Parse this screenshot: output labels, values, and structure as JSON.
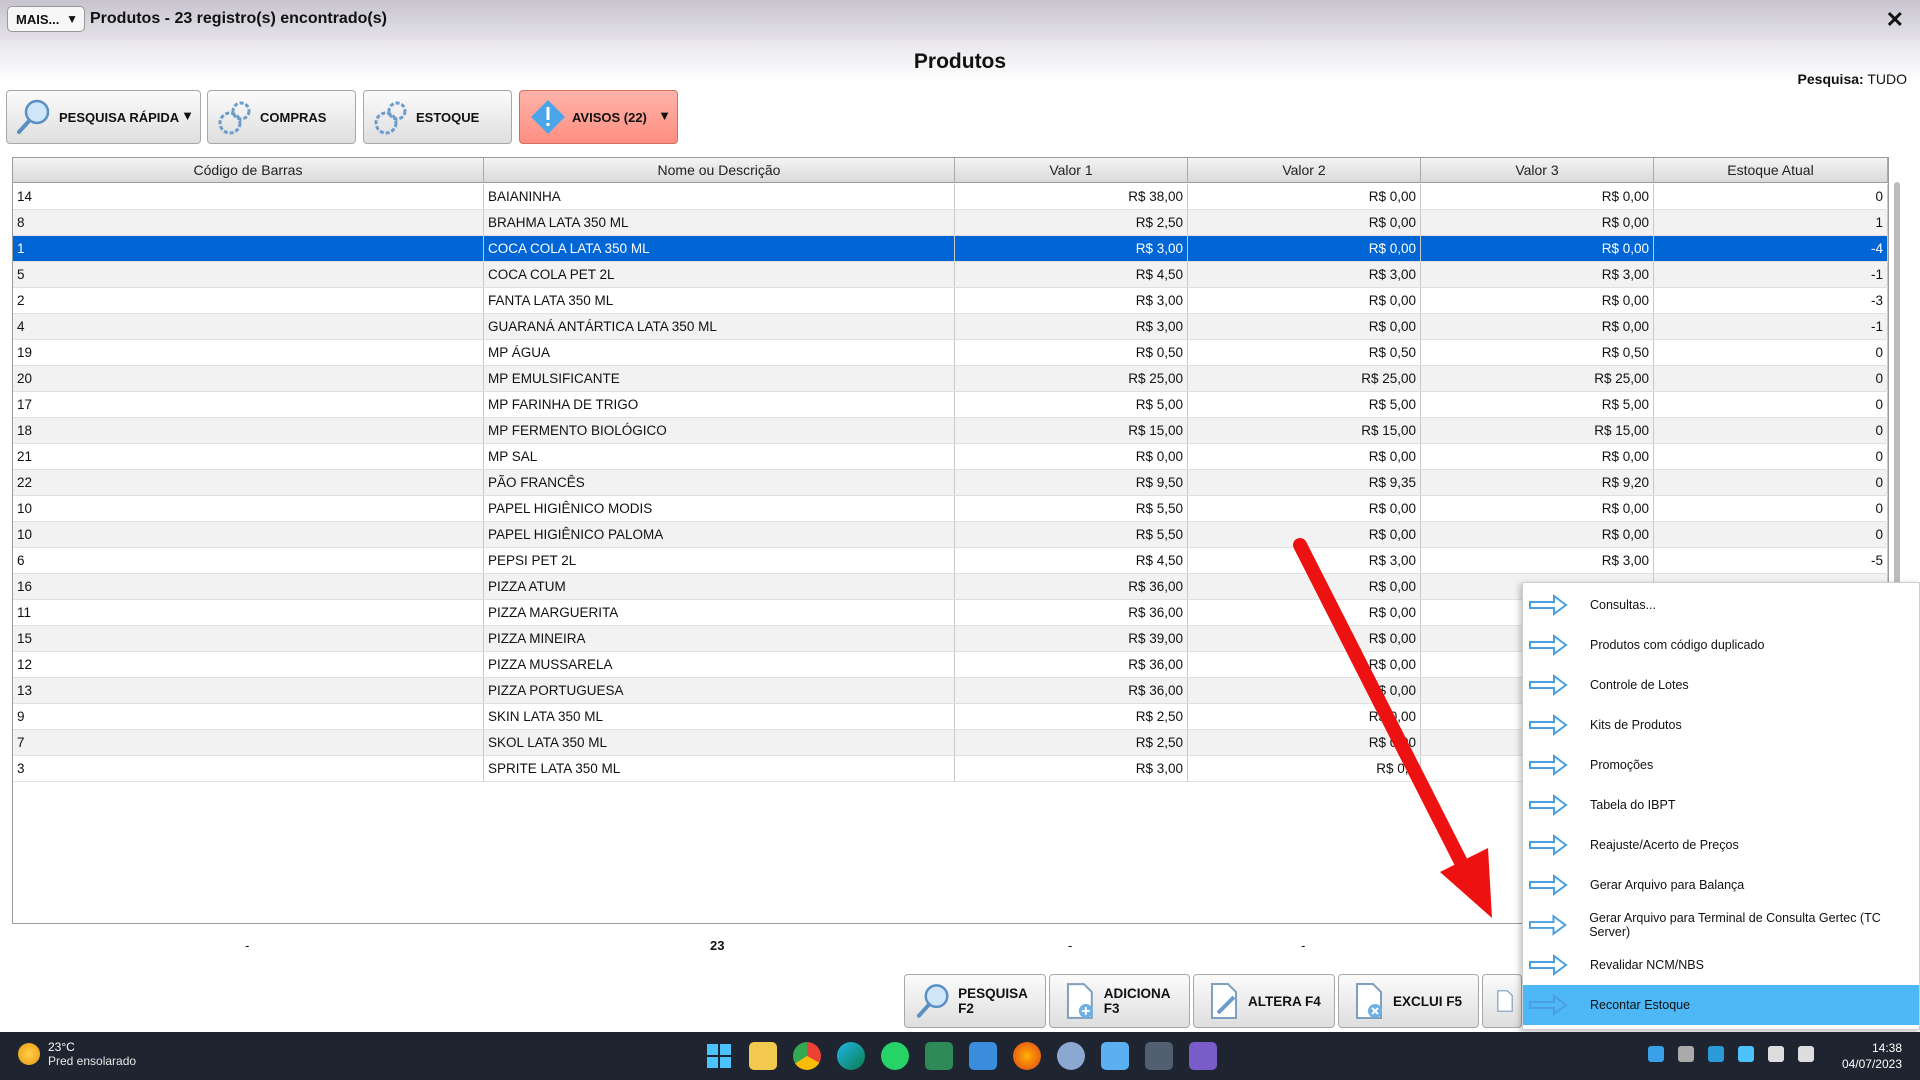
{
  "window": {
    "mais_label": "MAIS...",
    "title": "Produtos - 23 registro(s) encontrado(s)",
    "page_heading": "Produtos",
    "search_prefix": "Pesquisa:",
    "search_value": "TUDO"
  },
  "toolbar": {
    "quick_search": "PESQUISA RÁPIDA",
    "purchases": "COMPRAS",
    "stock": "ESTOQUE",
    "alerts": "AVISOS (22)"
  },
  "table": {
    "columns": [
      "Código de Barras",
      "Nome ou Descrição",
      "Valor 1",
      "Valor 2",
      "Valor 3",
      "Estoque Atual"
    ],
    "rows": [
      [
        "14",
        "BAIANINHA",
        "R$ 38,00",
        "R$ 0,00",
        "R$ 0,00",
        "0"
      ],
      [
        "8",
        "BRAHMA LATA 350 ML",
        "R$ 2,50",
        "R$ 0,00",
        "R$ 0,00",
        "1"
      ],
      [
        "1",
        "COCA COLA LATA 350 ML",
        "R$ 3,00",
        "R$ 0,00",
        "R$ 0,00",
        "-4"
      ],
      [
        "5",
        "COCA COLA PET 2L",
        "R$ 4,50",
        "R$ 3,00",
        "R$ 3,00",
        "-1"
      ],
      [
        "2",
        "FANTA LATA 350 ML",
        "R$ 3,00",
        "R$ 0,00",
        "R$ 0,00",
        "-3"
      ],
      [
        "4",
        "GUARANÁ ANTÁRTICA LATA 350 ML",
        "R$ 3,00",
        "R$ 0,00",
        "R$ 0,00",
        "-1"
      ],
      [
        "19",
        "MP ÁGUA",
        "R$ 0,50",
        "R$ 0,50",
        "R$ 0,50",
        "0"
      ],
      [
        "20",
        "MP EMULSIFICANTE",
        "R$ 25,00",
        "R$ 25,00",
        "R$ 25,00",
        "0"
      ],
      [
        "17",
        "MP FARINHA DE TRIGO",
        "R$ 5,00",
        "R$ 5,00",
        "R$ 5,00",
        "0"
      ],
      [
        "18",
        "MP FERMENTO BIOLÓGICO",
        "R$ 15,00",
        "R$ 15,00",
        "R$ 15,00",
        "0"
      ],
      [
        "21",
        "MP SAL",
        "R$ 0,00",
        "R$ 0,00",
        "R$ 0,00",
        "0"
      ],
      [
        "22",
        "PÃO FRANCÊS",
        "R$ 9,50",
        "R$ 9,35",
        "R$ 9,20",
        "0"
      ],
      [
        "10",
        "PAPEL HIGIÊNICO MODIS",
        "R$ 5,50",
        "R$ 0,00",
        "R$ 0,00",
        "0"
      ],
      [
        "10",
        "PAPEL HIGIÊNICO PALOMA",
        "R$ 5,50",
        "R$ 0,00",
        "R$ 0,00",
        "0"
      ],
      [
        "6",
        "PEPSI PET 2L",
        "R$ 4,50",
        "R$ 3,00",
        "R$ 3,00",
        "-5"
      ],
      [
        "16",
        "PIZZA ATUM",
        "R$ 36,00",
        "R$ 0,00",
        "",
        ""
      ],
      [
        "11",
        "PIZZA MARGUERITA",
        "R$ 36,00",
        "R$ 0,00",
        "",
        ""
      ],
      [
        "15",
        "PIZZA MINEIRA",
        "R$ 39,00",
        "R$ 0,00",
        "",
        ""
      ],
      [
        "12",
        "PIZZA MUSSARELA",
        "R$ 36,00",
        "R$ 0,00",
        "",
        ""
      ],
      [
        "13",
        "PIZZA PORTUGUESA",
        "R$ 36,00",
        "R$ 0,00",
        "",
        ""
      ],
      [
        "9",
        "SKIN LATA 350 ML",
        "R$ 2,50",
        "R$ 0,00",
        "",
        ""
      ],
      [
        "7",
        "SKOL LATA 350 ML",
        "R$ 2,50",
        "R$ 0,00",
        "",
        ""
      ],
      [
        "3",
        "SPRITE LATA 350 ML",
        "R$ 3,00",
        "R$ 0,0",
        "",
        ""
      ]
    ],
    "selected_row_index": 2
  },
  "totals": {
    "col1": "-",
    "count": "23",
    "col3": "-",
    "col4": "-"
  },
  "bottom_buttons": {
    "search": "PESQUISA F2",
    "add": "ADICIONA F3",
    "edit": "ALTERA F4",
    "delete": "EXCLUI F5"
  },
  "menu": {
    "items": [
      "Consultas...",
      "Produtos com código duplicado",
      "Controle de Lotes",
      "Kits de Produtos",
      "Promoções",
      "Tabela do IBPT",
      "Reajuste/Acerto de Preços",
      "Gerar Arquivo para Balança",
      "Gerar Arquivo para Terminal de Consulta Gertec (TC Server)",
      "Revalidar NCM/NBS",
      "Recontar Estoque"
    ],
    "active_index": 10
  },
  "taskbar": {
    "temperature": "23°C",
    "weather": "Pred ensolarado",
    "time": "14:38",
    "date": "04/07/2023"
  },
  "colors": {
    "selection": "#0066d6",
    "menu_highlight": "#4db8f5",
    "alert_button": "#ff8e82",
    "annotation_arrow": "#ee1111"
  }
}
